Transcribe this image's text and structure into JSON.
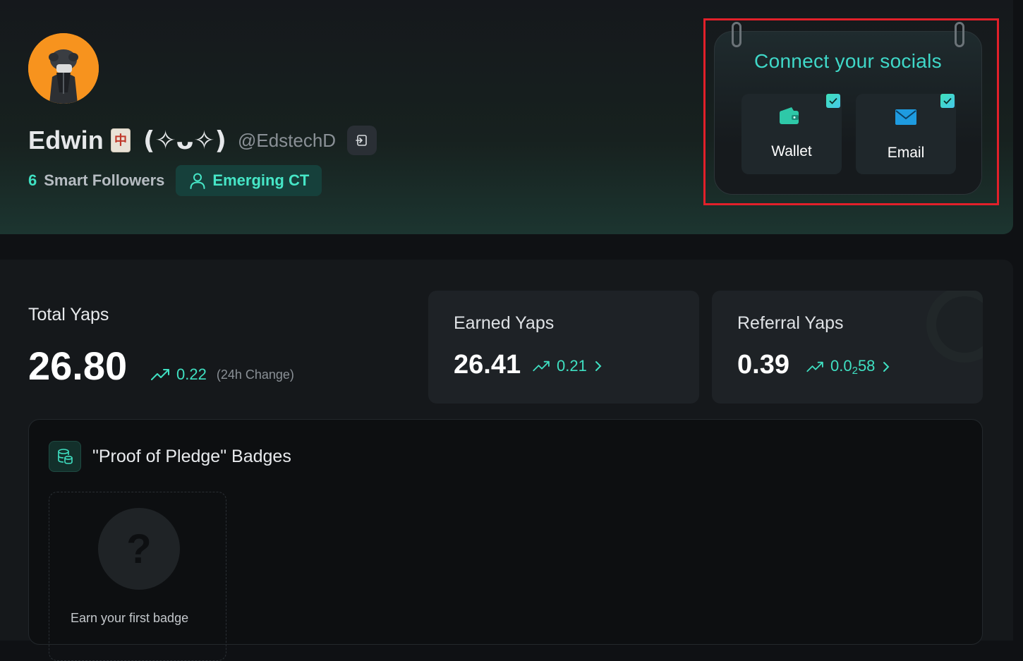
{
  "profile": {
    "display_name": "Edwin",
    "emoji_glyph": "中",
    "kaomoji": "(✧ᴗ✧)",
    "handle": "@EdstechD",
    "smart_followers_count": "6",
    "smart_followers_label": "Smart Followers",
    "tier_label": "Emerging CT"
  },
  "socials": {
    "title": "Connect your socials",
    "items": [
      {
        "label": "Wallet",
        "icon": "wallet-icon",
        "connected": true
      },
      {
        "label": "Email",
        "icon": "mail-icon",
        "connected": true
      }
    ]
  },
  "stats": {
    "total_label": "Total Yaps",
    "total_value": "26.80",
    "total_change": "0.22",
    "total_change_note": "(24h Change)",
    "earned_label": "Earned Yaps",
    "earned_value": "26.41",
    "earned_change": "0.21",
    "referral_label": "Referral Yaps",
    "referral_value": "0.39",
    "referral_change_prefix": "0.0",
    "referral_change_sub": "2",
    "referral_change_suffix": "58"
  },
  "badges": {
    "title": "\"Proof of Pledge\" Badges",
    "empty_text": "Earn your first badge",
    "placeholder_glyph": "?"
  },
  "colors": {
    "accent": "#3fe0c2",
    "highlight": "#e2202a",
    "background": "#0f1114"
  }
}
